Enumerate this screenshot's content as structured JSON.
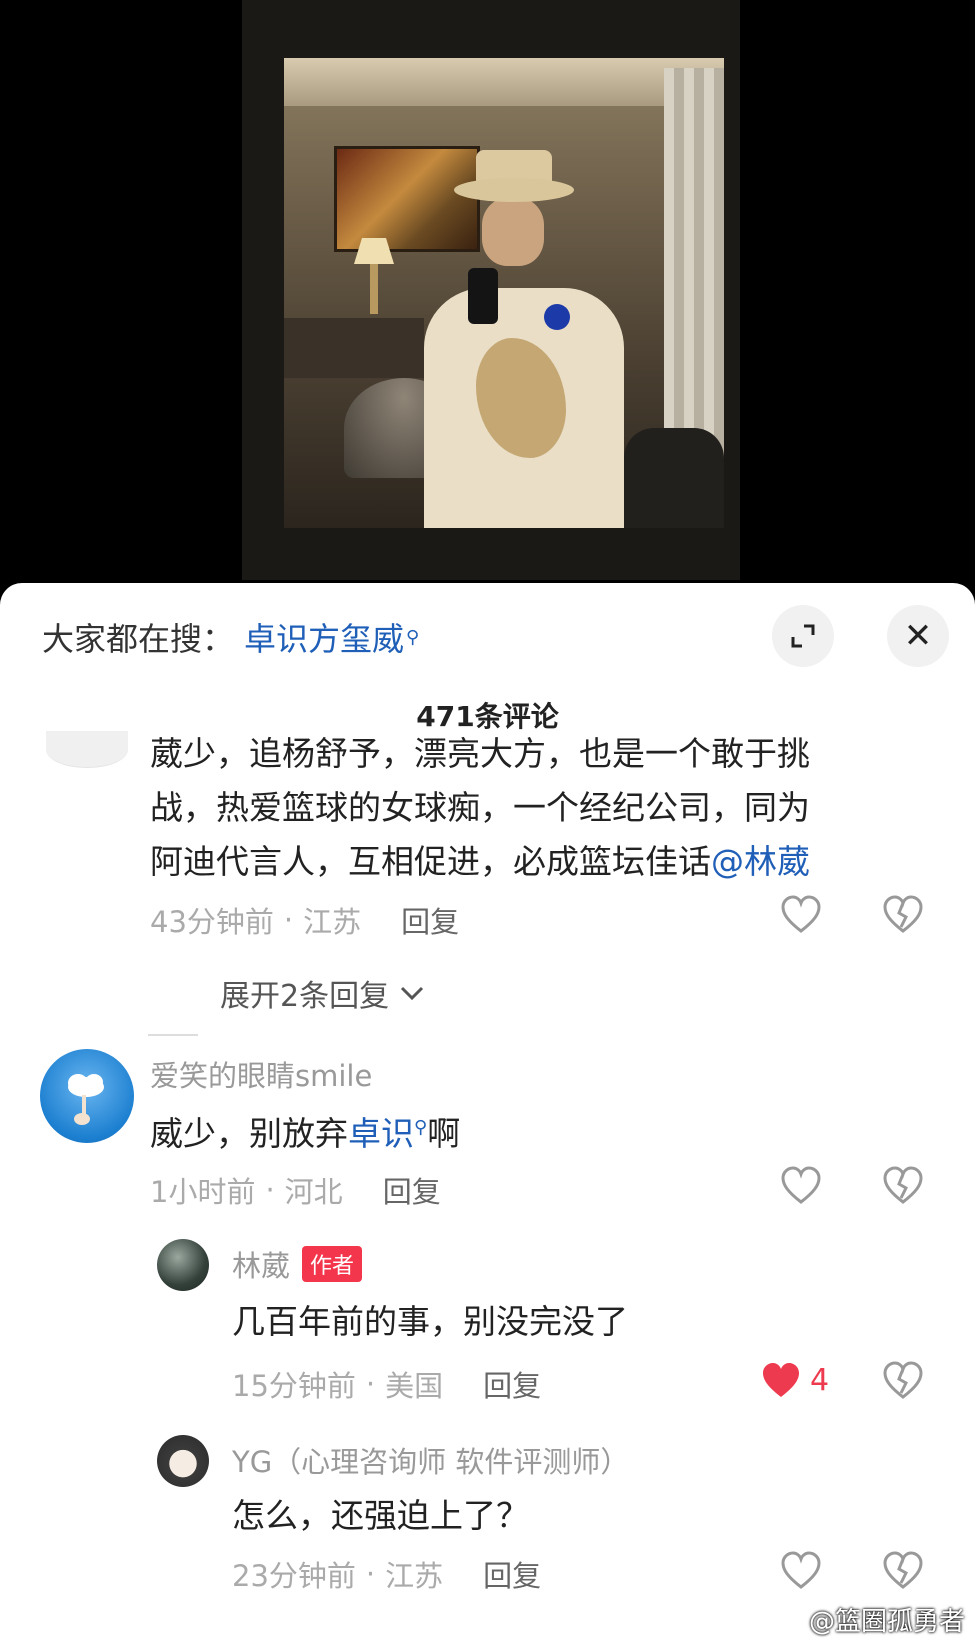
{
  "search": {
    "prefix": "大家都在搜：",
    "term": "卓识方玺威"
  },
  "header": {
    "comment_count": "471条评论"
  },
  "comments": [
    {
      "text_lines": [
        "葳少，追杨舒予，漂亮大方，也是一个敢于挑",
        "战，热爱篮球的女球痴，一个经纪公司，同为"
      ],
      "text_line3": "阿迪代言人，互相促进，必成篮坛佳话",
      "mention": "@林葳",
      "time": "43分钟前",
      "location": "江苏",
      "reply_label": "回复",
      "expand_label": "展开2条回复"
    },
    {
      "username": "爱笑的眼睛smile",
      "text_before": "威少，别放弃",
      "text_link": "卓识",
      "text_after": "啊",
      "time": "1小时前",
      "location": "河北",
      "reply_label": "回复",
      "replies": [
        {
          "username": "林葳",
          "tag": "作者",
          "text": "几百年前的事，别没完没了",
          "time": "15分钟前",
          "location": "美国",
          "reply_label": "回复",
          "like_count": "4"
        },
        {
          "username": "YG（心理咨询师 软件评测师）",
          "text": "怎么，还强迫上了？",
          "time": "23分钟前",
          "location": "江苏",
          "reply_label": "回复"
        }
      ]
    }
  ],
  "watermark": "@篮圈孤勇者",
  "colors": {
    "link": "#1f5fb8",
    "author_tag": "#f4364c",
    "liked_heart": "#ee3a4f"
  }
}
